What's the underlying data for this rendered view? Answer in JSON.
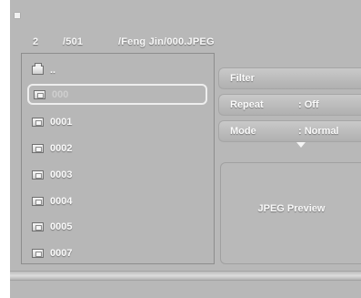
{
  "header": {
    "index": "2",
    "total": "/501",
    "path": "/Feng Jin/000.JPEG"
  },
  "file_list": {
    "items": [
      {
        "label": "..",
        "icon": "folder-up-icon",
        "selected": false
      },
      {
        "label": "000",
        "icon": "jpeg-file-icon",
        "selected": true
      },
      {
        "label": "0001",
        "icon": "jpeg-file-icon",
        "selected": false
      },
      {
        "label": "0002",
        "icon": "jpeg-file-icon",
        "selected": false
      },
      {
        "label": "0003",
        "icon": "jpeg-file-icon",
        "selected": false
      },
      {
        "label": "0004",
        "icon": "jpeg-file-icon",
        "selected": false
      },
      {
        "label": "0005",
        "icon": "jpeg-file-icon",
        "selected": false
      },
      {
        "label": "0007",
        "icon": "jpeg-file-icon",
        "selected": false
      }
    ]
  },
  "side_menu": {
    "filter_label": "Filter",
    "repeat_label": "Repeat",
    "repeat_value": ": Off",
    "mode_label": "Mode",
    "mode_value": ": Normal"
  },
  "preview": {
    "label": "JPEG Preview"
  },
  "colors": {
    "panel": "#b8b8b8",
    "text": "#f8f8f8",
    "selection": "#eeeeee"
  }
}
